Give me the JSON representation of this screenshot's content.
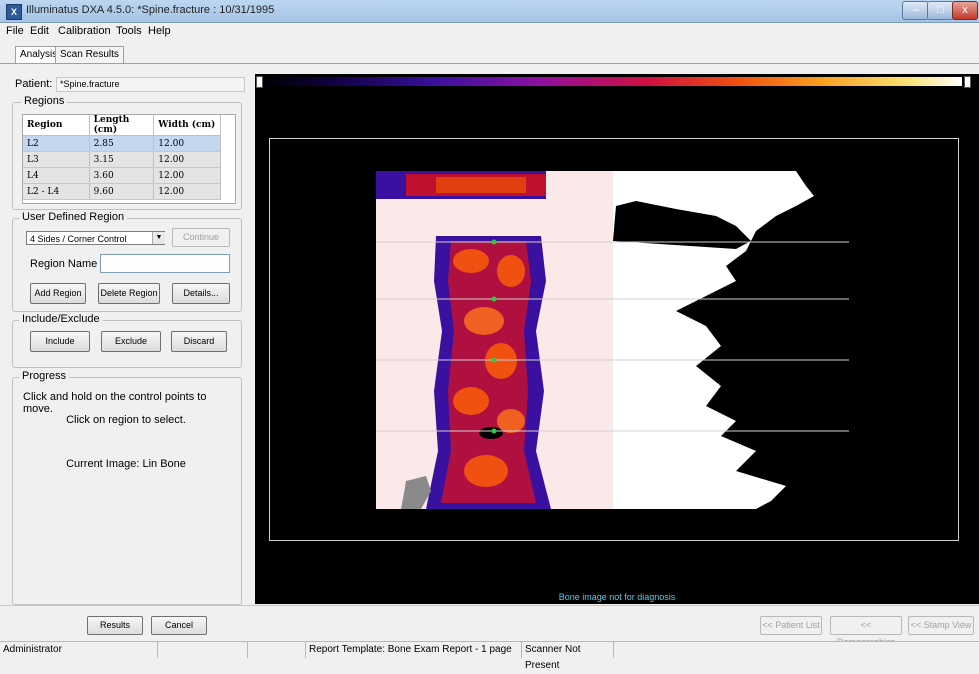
{
  "window": {
    "title": "Illuminatus DXA 4.5.0: *Spine.fracture : 10/31/1995",
    "app_icon_text": "X",
    "min_glyph": "–",
    "max_glyph": "□",
    "close_glyph": "x"
  },
  "menu": [
    "File",
    "Edit",
    "Calibration",
    "Tools",
    "Help"
  ],
  "tabs": [
    "Analysis",
    "Scan Results"
  ],
  "patient": {
    "label": "Patient:",
    "value": "*Spine.fracture"
  },
  "regions": {
    "title": "Regions",
    "columns": [
      "Region",
      "Length (cm)",
      "Width (cm)"
    ],
    "rows": [
      [
        "L2",
        "2.85",
        "12.00"
      ],
      [
        "L3",
        "3.15",
        "12.00"
      ],
      [
        "L4",
        "3.60",
        "12.00"
      ],
      [
        "L2 - L4",
        "9.60",
        "12.00"
      ]
    ],
    "selected_row": 0
  },
  "user_defined_region": {
    "title": "User Defined Region",
    "shape_value": "4 Sides / Corner Control",
    "continue_label": "Continue",
    "region_name_label": "Region Name",
    "region_name_value": "",
    "add_label": "Add Region",
    "delete_label": "Delete Region",
    "details_label": "Details..."
  },
  "include_exclude": {
    "title": "Include/Exclude",
    "include_label": "Include",
    "exclude_label": "Exclude",
    "discard_label": "Discard"
  },
  "progress": {
    "title": "Progress",
    "line1": "Click and hold on the control points to move.",
    "line2": "Click on region to select.",
    "line3": "Current Image: Lin Bone"
  },
  "viewer": {
    "disclaimer": "Bone image not for diagnosis",
    "roi_color": "#d0d0d0",
    "control_point_color": "#2ecc40",
    "scale_min_marker": "■",
    "scale_max_marker": "■"
  },
  "bottom_buttons": {
    "results": "Results",
    "cancel": "Cancel",
    "patient_list": "<< Patient List",
    "demographics": "<< Demographics",
    "stamp_view": "<< Stamp View"
  },
  "status_bar": {
    "user": "Administrator",
    "cell2": "",
    "cell3": "",
    "report_template": "Report Template: Bone Exam Report - 1 page",
    "scanner": "Scanner Not Present"
  }
}
